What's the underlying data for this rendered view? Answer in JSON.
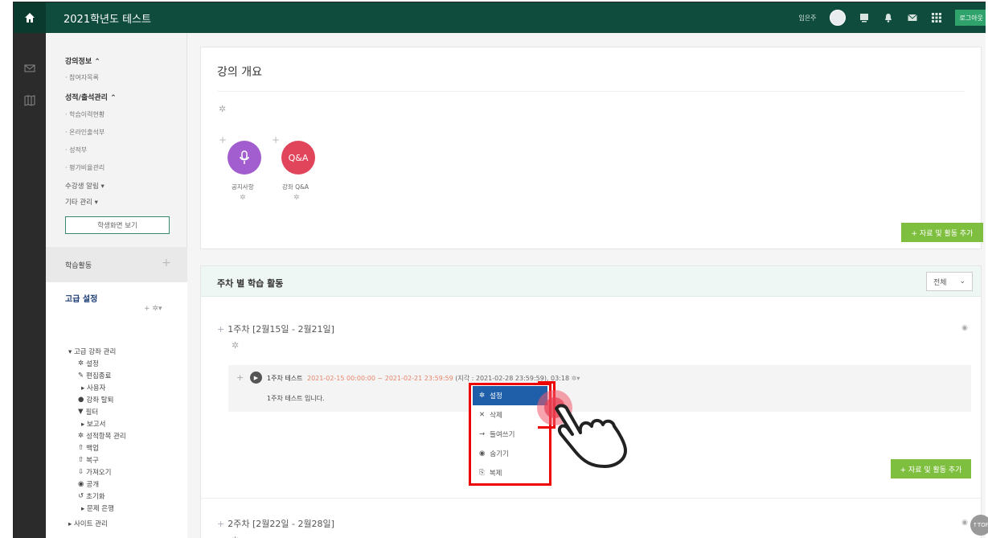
{
  "topbar": {
    "title": "2021학년도 테스트",
    "user_name": "임은주",
    "logout_label": "로그아웃",
    "icons": [
      "home-icon",
      "avatar",
      "monitor-icon",
      "bell-icon",
      "mail-icon",
      "grid-icon"
    ]
  },
  "sidebar": {
    "cut_top": "강의정보",
    "course_info": "강의정보 ⌃",
    "participants": "· 참여자목록",
    "grade_mgmt": "성적/출석관리 ⌃",
    "sub_items": [
      "· 학습이력현황",
      "· 온라인출석부",
      "· 성적부",
      "· 평가비율관리"
    ],
    "notify": "수강생 알림 ▾",
    "etc": "기타 관리 ▾",
    "student_view": "학생화면 보기",
    "learning": "학습활동",
    "advanced": "고급 설정",
    "adv_mgmt": "▾ 고급 강좌 관리",
    "adv_items": [
      "설정",
      "편집종료",
      "▸ 사용자",
      "강좌 탈퇴",
      "필터",
      "▸ 보고서",
      "성적항목 관리",
      "백업",
      "복구",
      "가져오기",
      "공개",
      "초기화",
      "▸ 문제 은행"
    ],
    "site_mgmt": "▸ 사이트 관리"
  },
  "main": {
    "overview_title": "강의 개요",
    "activities": [
      {
        "label": "공지사항",
        "color": "#a25ecf",
        "icon": "microphone-icon"
      },
      {
        "label": "강좌 Q&A",
        "color": "#e0455b",
        "icon_text": "Q&A"
      }
    ],
    "add_button": "+ 자료 및 활동 추가",
    "weekly_title": "주차 별 학습 활동",
    "filter_value": "전체",
    "week1": "1주차 [2월15일 - 2월21일]",
    "week2": "2주차 [2월22일 - 2월28일]",
    "activity_name": "1주차 테스트",
    "activity_dates": "2021-02-15 00:00:00 ~ 2021-02-21 23:59:59",
    "activity_extra": "(지각 : 2021-02-28 23:59:59), 03:18",
    "activity_desc": "1주차 테스트 입니다.",
    "add_button2": "+ 자료 및 활동 추가"
  },
  "menu": {
    "items": [
      "설정",
      "삭제",
      "들여쓰기",
      "숨기기",
      "복제"
    ]
  },
  "top_button": "TOP"
}
